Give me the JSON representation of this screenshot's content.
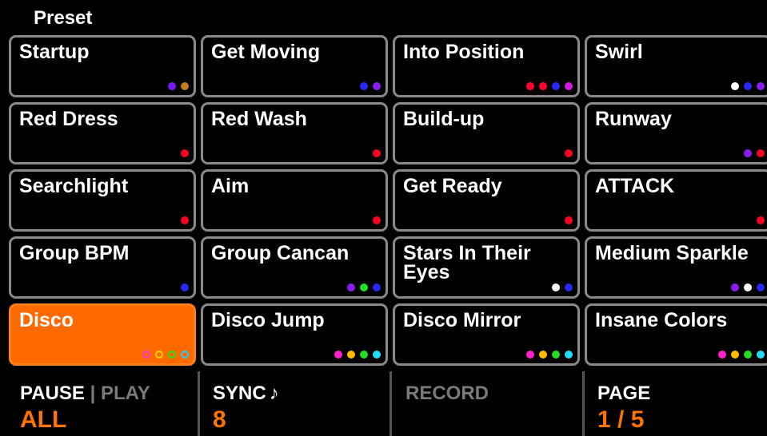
{
  "header": {
    "title": "Preset"
  },
  "presets": [
    {
      "name": "Startup",
      "dots": [
        "#7a1cf0",
        "#c27a20"
      ],
      "active": false
    },
    {
      "name": "Get Moving",
      "dots": [
        "#2a2af5",
        "#8a1cf0"
      ],
      "active": false
    },
    {
      "name": "Into Position",
      "dots": [
        "#ff0033",
        "#ff0033",
        "#2a2af5",
        "#d11ce0"
      ],
      "active": false
    },
    {
      "name": "Swirl",
      "dots": [
        "#ffffff",
        "#2a2af5",
        "#8a1cf0"
      ],
      "active": false
    },
    {
      "name": "Red Dress",
      "dots": [
        "#ff0022"
      ],
      "active": false
    },
    {
      "name": "Red Wash",
      "dots": [
        "#ff0022"
      ],
      "active": false
    },
    {
      "name": "Build-up",
      "dots": [
        "#ff0022"
      ],
      "active": false
    },
    {
      "name": "Runway",
      "dots": [
        "#8a1cf0",
        "#ff0022"
      ],
      "active": false
    },
    {
      "name": "Searchlight",
      "dots": [
        "#ff0022"
      ],
      "active": false
    },
    {
      "name": "Aim",
      "dots": [
        "#ff0022"
      ],
      "active": false
    },
    {
      "name": "Get Ready",
      "dots": [
        "#ff0022"
      ],
      "active": false
    },
    {
      "name": "ATTACK",
      "dots": [
        "#ff0022"
      ],
      "active": false
    },
    {
      "name": "Group BPM",
      "dots": [
        "#2a2af5"
      ],
      "active": false
    },
    {
      "name": "Group Cancan",
      "dots": [
        "#8a1cf0",
        "#22dd22",
        "#2a2af5"
      ],
      "active": false
    },
    {
      "name": "Stars In Their Eyes",
      "dots": [
        "#ffffff",
        "#2a2af5"
      ],
      "active": false
    },
    {
      "name": "Medium Sparkle",
      "dots": [
        "#8a1cf0",
        "#ffffff",
        "#2a2af5"
      ],
      "active": false
    },
    {
      "name": "Disco",
      "dots": [
        "#ff33cc",
        "#ffcc00",
        "#22dd22",
        "#22ccff"
      ],
      "active": true
    },
    {
      "name": "Disco Jump",
      "dots": [
        "#ff22cc",
        "#ffbb00",
        "#22dd22",
        "#22ddff"
      ],
      "active": false
    },
    {
      "name": "Disco Mirror",
      "dots": [
        "#ff22cc",
        "#ffbb00",
        "#22dd22",
        "#22ddff"
      ],
      "active": false
    },
    {
      "name": "Insane Colors",
      "dots": [
        "#ff22cc",
        "#ffbb00",
        "#22dd22",
        "#22ddff"
      ],
      "active": false
    }
  ],
  "footer": {
    "pause_label": "PAUSE",
    "separator": "|",
    "play_label": "PLAY",
    "pause_value": "ALL",
    "sync_label": "SYNC",
    "sync_icon": "♪",
    "sync_value": "8",
    "record_label": "RECORD",
    "page_label": "PAGE",
    "page_value": "1 / 5"
  },
  "colors": {
    "accent": "#ff7300",
    "tile_border": "#8a8a8a",
    "active_tile": "#ff6a00"
  }
}
